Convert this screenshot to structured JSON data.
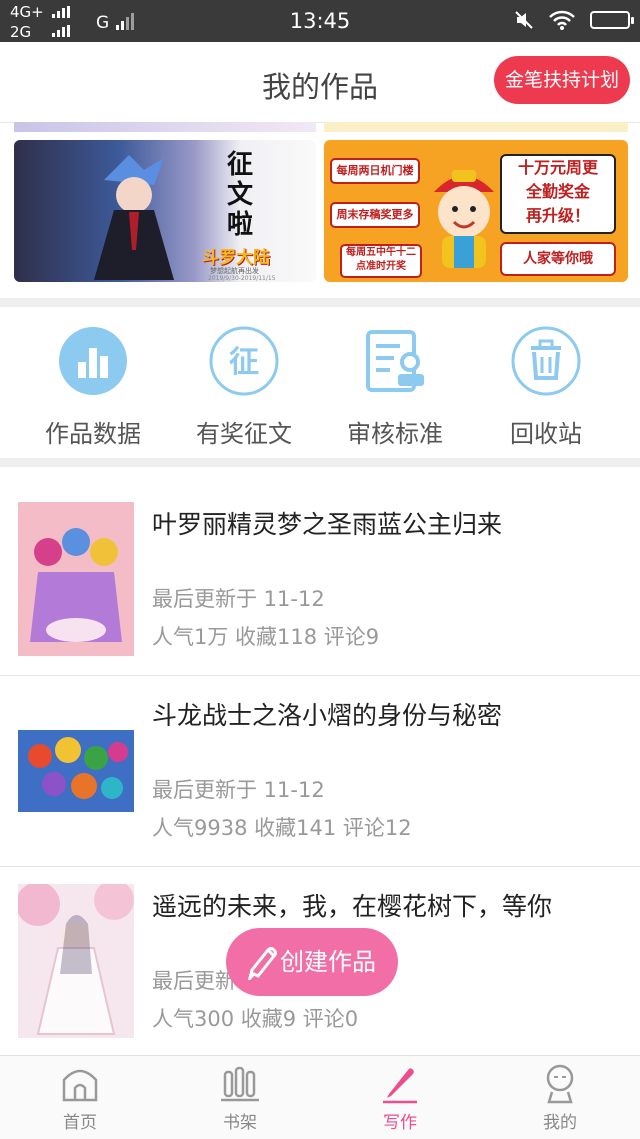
{
  "status_bar": {
    "network_1": "4G+",
    "network_2": "2G",
    "network_3": "G",
    "time": "13:45"
  },
  "header": {
    "title": "我的作品",
    "action_button": "金笔扶持计划"
  },
  "banners": {
    "left": {
      "headline": "征文啦",
      "subtitle": "斗罗大陆",
      "tagline": "梦想起航再出发",
      "date": "2019/9/30-2019/11/15"
    },
    "right": {
      "box_1": "每周两日机门楼",
      "box_2": "周末存稿奖更多",
      "box_3": "每周五中午十二点准时开奖",
      "big_text": [
        "十万元周更",
        "全勤奖金",
        "再升级！"
      ],
      "small_text": "人家等你哦"
    }
  },
  "tools": [
    {
      "label": "作品数据",
      "icon": "bar-chart-icon"
    },
    {
      "label": "有奖征文",
      "icon": "contest-icon",
      "glyph": "征"
    },
    {
      "label": "审核标准",
      "icon": "review-document-icon"
    },
    {
      "label": "回收站",
      "icon": "trash-icon"
    }
  ],
  "works": [
    {
      "title": "叶罗丽精灵梦之圣雨蓝公主归来",
      "update": "最后更新于 11-12",
      "stats": "人气1万 收藏118 评论9"
    },
    {
      "title": "斗龙战士之洛小熠的身份与秘密",
      "update": "最后更新于 11-12",
      "stats": "人气9938 收藏141 评论12"
    },
    {
      "title": "遥远的未来，我，在樱花树下，等你",
      "update": "最后更新",
      "stats": "人气300 收藏9 评论0"
    }
  ],
  "fab": {
    "label": "创建作品"
  },
  "tabbar": [
    {
      "label": "首页",
      "icon": "home-icon"
    },
    {
      "label": "书架",
      "icon": "bookshelf-icon"
    },
    {
      "label": "写作",
      "icon": "pen-icon",
      "active": true
    },
    {
      "label": "我的",
      "icon": "profile-icon"
    }
  ],
  "colors": {
    "accent_red": "#ee3a4e",
    "accent_pink": "#f16fa6",
    "icon_blue": "#8ccaf0",
    "banner_orange": "#f6a323"
  }
}
